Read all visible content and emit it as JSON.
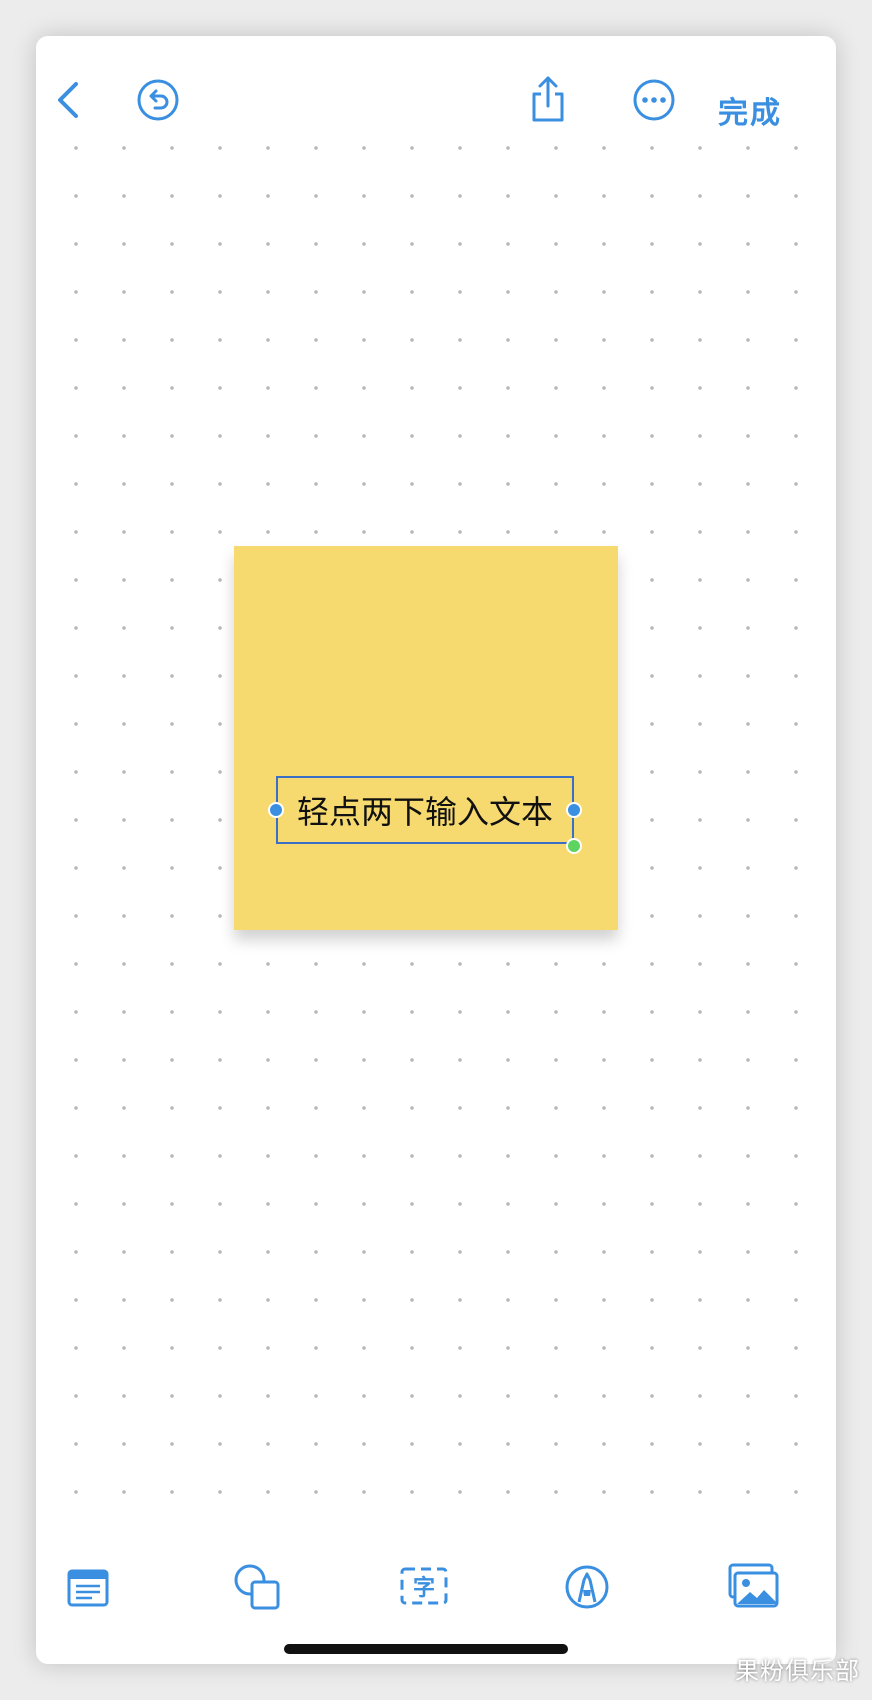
{
  "toolbar": {
    "back_icon": "chevron-left-icon",
    "undo_icon": "undo-icon",
    "share_icon": "share-icon",
    "more_icon": "ellipsis-circle-icon",
    "done_label": "完成"
  },
  "sticky_note": {
    "placeholder_text": "轻点两下输入文本",
    "color": "#f6da6f"
  },
  "bottom_toolbar": {
    "items": [
      {
        "icon": "sticky-note-icon"
      },
      {
        "icon": "shapes-icon"
      },
      {
        "icon": "text-box-icon",
        "glyph": "字"
      },
      {
        "icon": "pen-icon"
      },
      {
        "icon": "photos-icon"
      }
    ]
  },
  "watermark": "果粉俱乐部",
  "colors": {
    "accent": "#3a8fe0",
    "selection": "#3a6fc8",
    "rotate_handle": "#5fd35f"
  }
}
